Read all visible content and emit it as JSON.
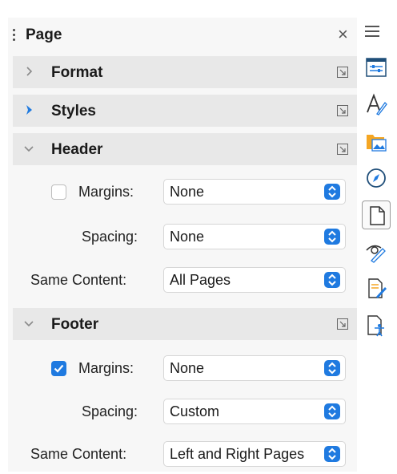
{
  "panel": {
    "title": "Page",
    "close_glyph": "×"
  },
  "sections": {
    "format": {
      "label": "Format",
      "state": "collapsed"
    },
    "styles": {
      "label": "Styles",
      "state": "collapsed-highlighted"
    },
    "header": {
      "label": "Header",
      "state": "expanded"
    },
    "footer": {
      "label": "Footer",
      "state": "expanded"
    }
  },
  "header": {
    "margins_label": "Margins:",
    "margins_checked": false,
    "margins_value": "None",
    "spacing_label": "Spacing:",
    "spacing_value": "None",
    "same_content_label": "Same Content:",
    "same_content_value": "All Pages"
  },
  "footer": {
    "margins_label": "Margins:",
    "margins_checked": true,
    "margins_value": "None",
    "spacing_label": "Spacing:",
    "spacing_value": "Custom",
    "same_content_label": "Same Content:",
    "same_content_value": "Left and Right Pages"
  },
  "tabbar": {
    "items": [
      {
        "icon": "properties-icon"
      },
      {
        "icon": "styles-icon"
      },
      {
        "icon": "gallery-icon"
      },
      {
        "icon": "navigator-icon"
      },
      {
        "icon": "page-icon",
        "active": true
      },
      {
        "icon": "style-inspector-icon"
      },
      {
        "icon": "manage-changes-icon"
      },
      {
        "icon": "accessibility-check-icon"
      }
    ]
  },
  "colors": {
    "accent": "#1f7ae0",
    "section_bg": "#e8e8e8",
    "panel_bg": "#f7f7f7"
  }
}
